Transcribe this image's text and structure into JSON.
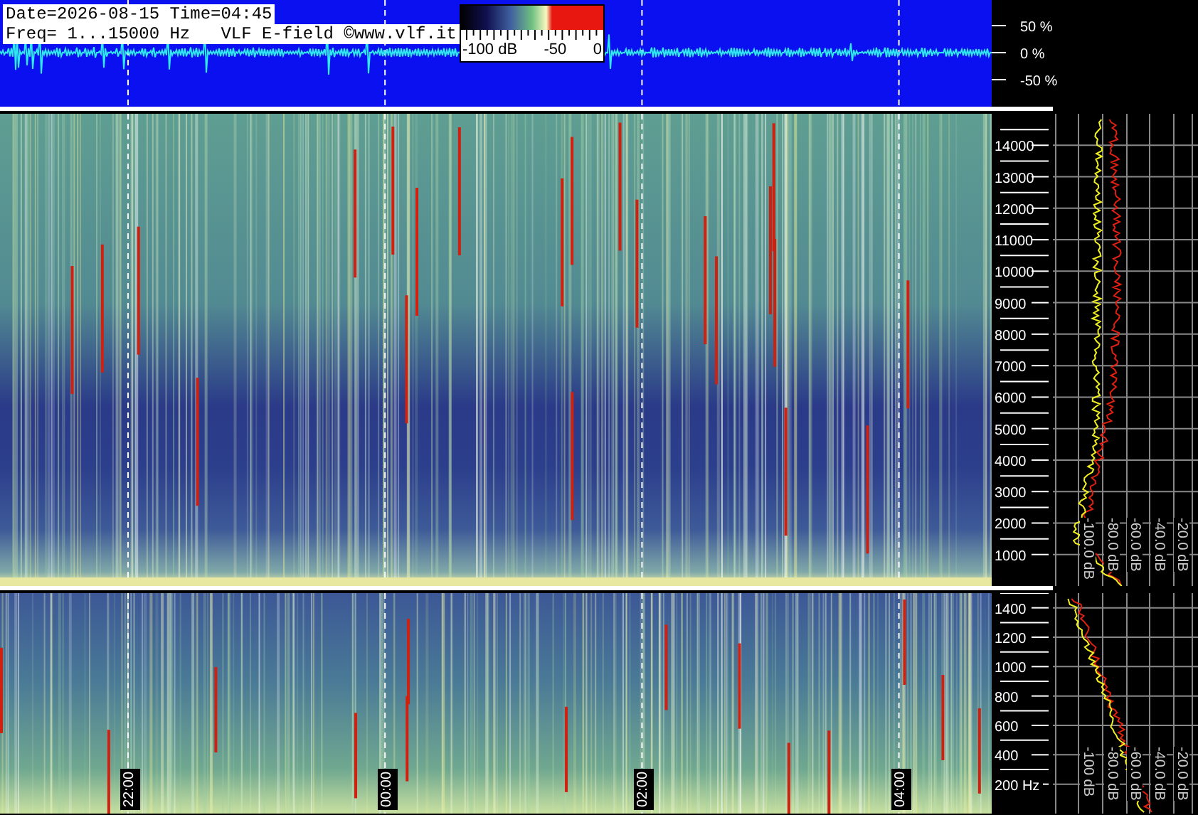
{
  "header": {
    "date_line": "Date=2026-08-15 Time=04:45",
    "info_line": "Freq= 1...15000 Hz   VLF E-field ©www.vlf.it"
  },
  "color_scale": {
    "labels": [
      "-100 dB",
      "-50",
      "0"
    ]
  },
  "waveform": {
    "axis_labels": [
      "50 %",
      "0 %",
      "-50 %"
    ]
  },
  "spectrogram_main": {
    "freq_labels": [
      "14000",
      "13000",
      "12000",
      "11000",
      "10000",
      "9000",
      "8000",
      "7000",
      "6000",
      "5000",
      "4000",
      "3000",
      "2000",
      "1000"
    ],
    "db_labels": [
      "-100.0 dB",
      "-80.0 dB",
      "-60.0 dB",
      "-40.0 dB",
      "-20.0 dB"
    ]
  },
  "spectrogram_low": {
    "freq_labels": [
      "1400",
      "1200",
      "1000",
      "800",
      "600",
      "400",
      "200 Hz"
    ],
    "db_labels": [
      "-100 dB",
      "-80.0 dB",
      "-60.0 dB",
      "-40.0 dB",
      "-20.0 dB"
    ],
    "time_labels": [
      "22:00",
      "00:00",
      "02:00",
      "04:00"
    ]
  }
}
